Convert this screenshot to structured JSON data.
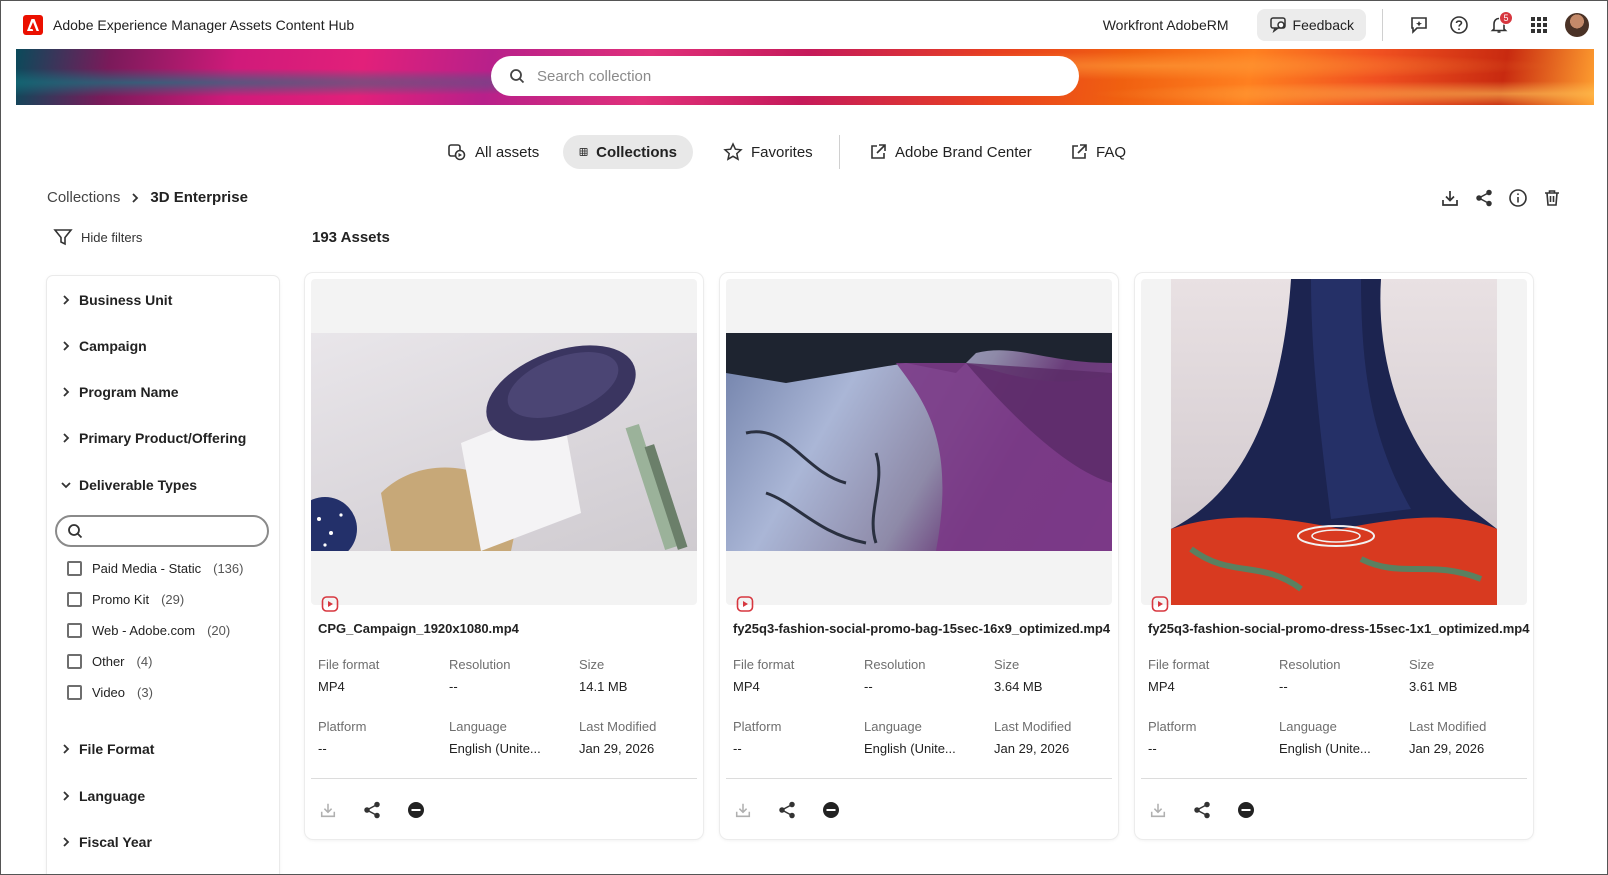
{
  "app": {
    "title": "Adobe Experience Manager Assets Content Hub",
    "org": "Workfront AdobeRM",
    "feedback_label": "Feedback",
    "notification_count": "5"
  },
  "search": {
    "placeholder": "Search collection"
  },
  "nav": {
    "all_assets": "All assets",
    "collections": "Collections",
    "favorites": "Favorites",
    "brand_center": "Adobe Brand Center",
    "faq": "FAQ"
  },
  "breadcrumb": {
    "parent": "Collections",
    "current": "3D Enterprise"
  },
  "toolbar": {
    "hide_filters": "Hide filters",
    "asset_count": "193 Assets"
  },
  "filters": {
    "business_unit": "Business Unit",
    "campaign": "Campaign",
    "program_name": "Program Name",
    "primary_product": "Primary Product/Offering",
    "deliverable_types": "Deliverable Types",
    "file_format": "File Format",
    "language": "Language",
    "fiscal_year": "Fiscal Year",
    "options": [
      {
        "label": "Paid Media - Static",
        "count": "(136)"
      },
      {
        "label": "Promo Kit",
        "count": "(29)"
      },
      {
        "label": "Web - Adobe.com",
        "count": "(20)"
      },
      {
        "label": "Other",
        "count": "(4)"
      },
      {
        "label": "Video",
        "count": "(3)"
      }
    ]
  },
  "labels": {
    "file_format": "File format",
    "resolution": "Resolution",
    "size": "Size",
    "platform": "Platform",
    "language": "Language",
    "last_modified": "Last Modified"
  },
  "cards": [
    {
      "name": "CPG_Campaign_1920x1080.mp4",
      "format": "MP4",
      "resolution": "--",
      "size": "14.1 MB",
      "platform": "--",
      "language": "English (Unite...",
      "modified": "Jan 29, 2026"
    },
    {
      "name": "fy25q3-fashion-social-promo-bag-15sec-16x9_optimized.mp4",
      "format": "MP4",
      "resolution": "--",
      "size": "3.64 MB",
      "platform": "--",
      "language": "English (Unite...",
      "modified": "Jan 29, 2026"
    },
    {
      "name": "fy25q3-fashion-social-promo-dress-15sec-1x1_optimized.mp4",
      "format": "MP4",
      "resolution": "--",
      "size": "3.61 MB",
      "platform": "--",
      "language": "English (Unite...",
      "modified": "Jan 29, 2026"
    }
  ]
}
